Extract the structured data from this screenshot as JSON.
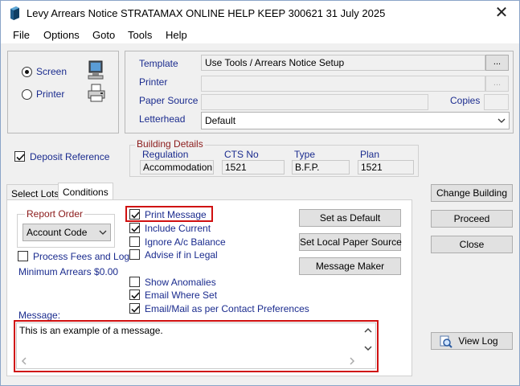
{
  "window": {
    "title": "Levy Arrears Notice STRATAMAX ONLINE HELP KEEP 300621 31 July 2025",
    "close_glyph": "✕"
  },
  "menu": [
    "File",
    "Options",
    "Goto",
    "Tools",
    "Help"
  ],
  "output": {
    "screen_label": "Screen",
    "printer_label": "Printer",
    "selected": "Screen"
  },
  "print_settings": {
    "template_label": "Template",
    "template_value": "Use Tools / Arrears Notice Setup",
    "browse_label": "...",
    "printer_label": "Printer",
    "printer_value": "",
    "printer_browse_label": "...",
    "paper_source_label": "Paper Source",
    "paper_source_value": "",
    "copies_label": "Copies",
    "copies_value": "",
    "letterhead_label": "Letterhead",
    "letterhead_value": "Default"
  },
  "deposit_reference": {
    "label": "Deposit Reference",
    "checked": true
  },
  "building_details": {
    "title": "Building Details",
    "regulation_label": "Regulation",
    "regulation_value": "Accommodation",
    "cts_label": "CTS No",
    "cts_value": "1521",
    "type_label": "Type",
    "type_value": "B.F.P.",
    "plan_label": "Plan",
    "plan_value": "1521"
  },
  "tabs": [
    {
      "label": "Select Lots",
      "active": false
    },
    {
      "label": "Conditions",
      "active": true
    }
  ],
  "conditions": {
    "report_order_title": "Report Order",
    "report_order_value": "Account Code",
    "process_fees_label": "Process Fees and Log",
    "min_arrears_label": "Minimum Arrears $0.00",
    "options": [
      {
        "label": "Print Message",
        "checked": true
      },
      {
        "label": "Include Current",
        "checked": true
      },
      {
        "label": "Ignore A/c Balance",
        "checked": false
      },
      {
        "label": "Advise if in Legal",
        "checked": false
      },
      {
        "label": "Show Anomalies",
        "checked": false
      },
      {
        "label": "Email Where Set",
        "checked": true
      },
      {
        "label": "Email/Mail as per Contact Preferences",
        "checked": true
      }
    ],
    "set_default_label": "Set as Default",
    "set_local_paper_label": "Set Local Paper Source",
    "message_maker_label": "Message Maker",
    "message_label": "Message:",
    "message_text": "This is an example of a message."
  },
  "actions": {
    "change_building_label": "Change Building",
    "proceed_label": "Proceed",
    "close_label": "Close",
    "view_log_label": "View Log"
  },
  "colors": {
    "label_blue": "#1a2b8e",
    "group_title_red": "#8b1a1a",
    "highlight_red": "#d01010"
  }
}
